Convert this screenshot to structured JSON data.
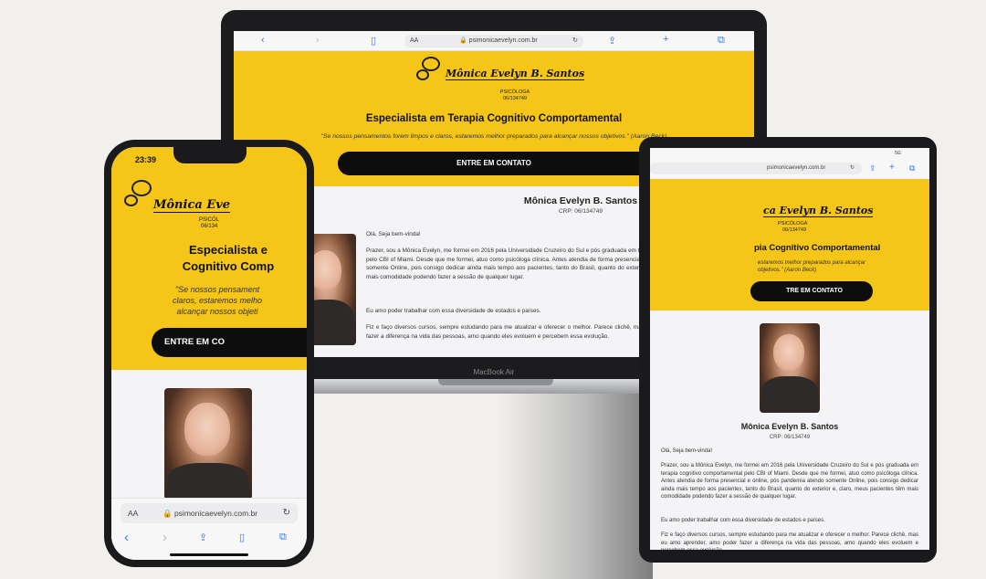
{
  "site": {
    "logo_name": "Mônica Evelyn B. Santos",
    "logo_subtitle": "PSICÓLOGA",
    "logo_crp": "06/134749",
    "headline": "Especialista em Terapia Cognitivo Comportamental",
    "quote": "\"Se nossos pensamentos forem limpos e claros, estaremos melhor preparados para alcançar nossos objetivos.\" (Aaron Beck)",
    "cta_label": "ENTRE EM CONTATO",
    "profile_name": "Mônica Evelyn B. Santos",
    "profile_crp": "CRP: 06/134749",
    "greeting": "Olá, Seja bem-vinda!",
    "bio_p1": "Prazer, sou a Mônica Evelyn, me formei em 2016 pela Universidade Cruzeiro do Sul e pós graduada em terapia cognitivo comportamental pelo CBI of Miami. Desde que me formei, atuo como psicóloga clínica. Antes atendia de forma presencial e online, pós pandemia atendo somente Online, pois consigo dedicar ainda mais tempo aos pacientes, tanto do Brasil, quanto do exterior e, claro, meus pacientes têm mais comodidade podendo fazer a sessão de qualquer lugar.",
    "bio_p2": "Eu amo poder trabalhar com essa diversidade de estados e países.",
    "bio_p3": "Fiz e faço diversos cursos, sempre estudando para me atualizar e oferecer o melhor. Parece clichê, mas eu amo aprender, amo poder fazer a diferença na vida das pessoas, amo quando eles evoluem e percebem essa evolução."
  },
  "laptop": {
    "url_aa": "AA",
    "url": "psimonicaevelyn.com.br",
    "model_label": "MacBook Air"
  },
  "phone": {
    "time": "23:39",
    "url_aa": "AA",
    "url": "psimonicaevelyn.com.br",
    "headline_visible": "Especialista e\nCognitivo Comp",
    "quote_visible": "\"Se nossos pensament\nclaros, estaremos melho\nalcançar nossos objeti",
    "cta_visible": "ENTRE EM CO",
    "logo_visible": "Mônica Eve",
    "subtitle_visible": "PSICÓL",
    "crp_visible": "06/134"
  },
  "tablet": {
    "url": "psimonicaevelyn.com.br",
    "logo_visible": "ca Evelyn B. Santos",
    "headline_visible": "pia Cognitivo Comportamental",
    "quote_visible": "estaremos melhor preparados para alcançar\nobjetivos.\" (Aaron Beck)",
    "cta_visible": "TRE EM CONTATO",
    "status": "5G"
  },
  "colors": {
    "brand_yellow": "#f5c518",
    "button_black": "#0d0d0d",
    "safari_blue": "#2f7bf5"
  }
}
